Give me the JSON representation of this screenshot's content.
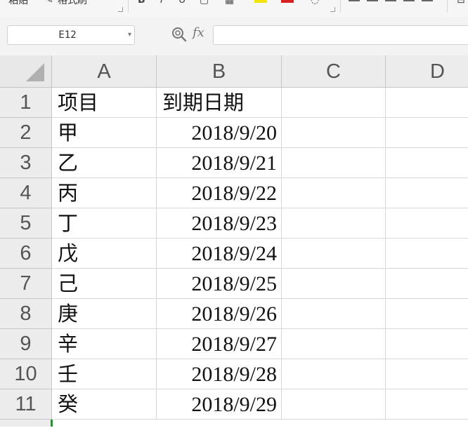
{
  "toolbar": {
    "paste_label": "粘贴",
    "format_painter_label": "格式刷",
    "bold_glyph": "B",
    "italic_glyph": "I",
    "highlight_color": "#f2e500",
    "font_color": "#d92020"
  },
  "formula_bar": {
    "name_box_value": "E12",
    "formula_value": "",
    "fx_label": "fx"
  },
  "columns": [
    "A",
    "B",
    "C",
    "D"
  ],
  "rows": [
    {
      "num": "1",
      "a": "项目",
      "b": "到期日期"
    },
    {
      "num": "2",
      "a": "甲",
      "b": "2018/9/20"
    },
    {
      "num": "3",
      "a": "乙",
      "b": "2018/9/21"
    },
    {
      "num": "4",
      "a": "丙",
      "b": "2018/9/22"
    },
    {
      "num": "5",
      "a": "丁",
      "b": "2018/9/23"
    },
    {
      "num": "6",
      "a": "戊",
      "b": "2018/9/24"
    },
    {
      "num": "7",
      "a": "己",
      "b": "2018/9/25"
    },
    {
      "num": "8",
      "a": "庚",
      "b": "2018/9/26"
    },
    {
      "num": "9",
      "a": "辛",
      "b": "2018/9/27"
    },
    {
      "num": "10",
      "a": "壬",
      "b": "2018/9/28"
    },
    {
      "num": "11",
      "a": "癸",
      "b": "2018/9/29"
    }
  ],
  "colors": {
    "header_bg": "#ececec",
    "active_marker": "#2e8b3a"
  }
}
